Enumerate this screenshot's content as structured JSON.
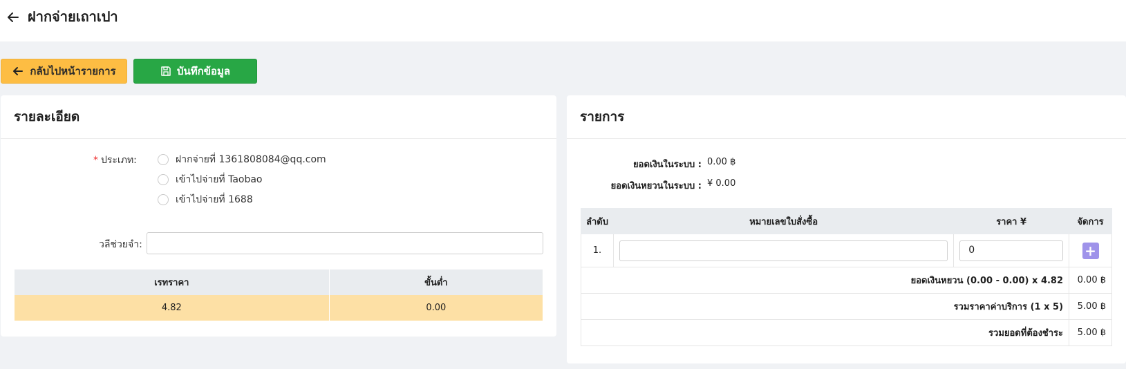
{
  "header": {
    "title": "ฝากจ่ายเถาเปา"
  },
  "toolbar": {
    "back_label": "กลับไปหน้ารายการ",
    "save_label": "บันทึกข้อมูล"
  },
  "details": {
    "title": "รายละเอียด",
    "type_label": "ประเภท",
    "required_mark": "*",
    "colon": ":",
    "type_options": [
      "ฝากจ่ายที่ 1361808084@qq.com",
      "เข้าไปจ่ายที่ Taobao",
      "เข้าไปจ่ายที่ 1688"
    ],
    "memo_label": "วลีช่วยจำ",
    "rate_table": {
      "headers": [
        "เรทราคา",
        "ขั้นต่ำ"
      ],
      "row": [
        "4.82",
        "0.00"
      ]
    }
  },
  "items": {
    "title": "รายการ",
    "balance_label": "ยอดเงินในระบบ",
    "balance_value": "0.00 ฿",
    "yuan_balance_label": "ยอดเงินหยวนในระบบ",
    "yuan_balance_value": "¥ 0.00",
    "table": {
      "headers": [
        "ลำดับ",
        "หมายเลขใบสั่งซื้อ",
        "ราคา ¥",
        "จัดการ"
      ],
      "row": {
        "index": "1.",
        "order_no": "",
        "price": "0"
      },
      "add_icon": "+",
      "summary": [
        {
          "label": "ยอดเงินหยวน (0.00 - 0.00) x 4.82",
          "value": "0.00 ฿"
        },
        {
          "label": "รวมราคาค่าบริการ (1 x 5)",
          "value": "5.00 ฿"
        },
        {
          "label": "รวมยอดที่ต้องชำระ",
          "value": "5.00 ฿"
        }
      ]
    }
  },
  "colors": {
    "back_button": "#fdbd43",
    "save_button": "#28a745",
    "add_button": "#9f93ea",
    "highlight_row": "#fde0a5"
  },
  "icons": {
    "back": "arrow-left-icon",
    "save": "floppy-disk-icon",
    "add": "plus-icon"
  }
}
